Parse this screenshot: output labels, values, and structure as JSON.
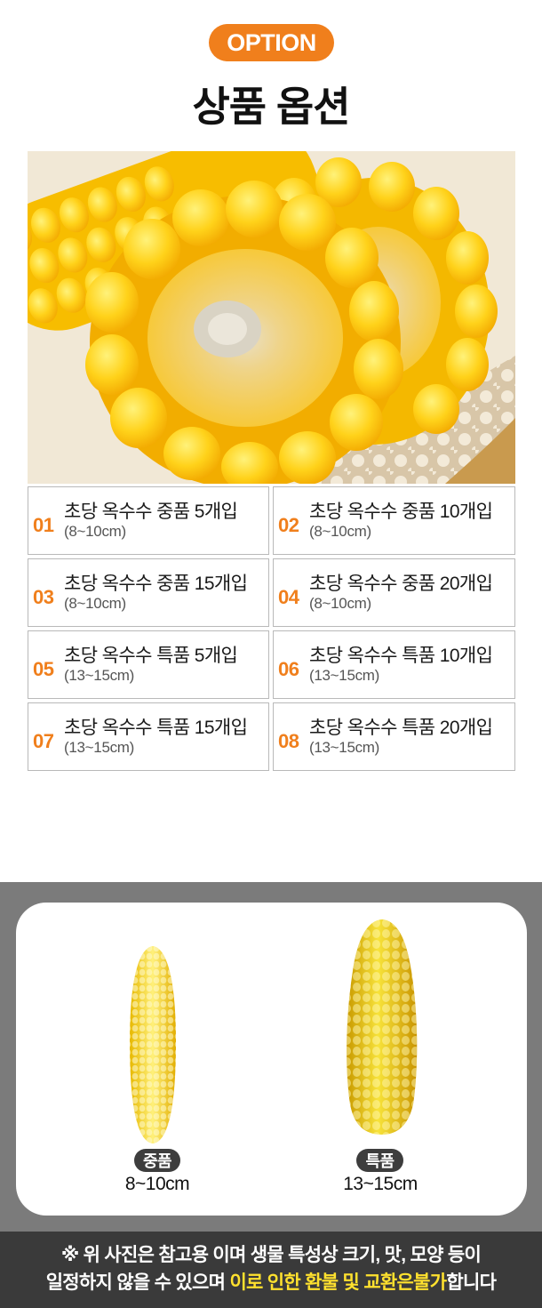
{
  "header": {
    "badge": "OPTION",
    "title": "상품 옵션"
  },
  "options": [
    {
      "num": "01",
      "name": "초당 옥수수 중품 5개입",
      "size": "(8~10cm)"
    },
    {
      "num": "02",
      "name": "초당 옥수수 중품 10개입",
      "size": "(8~10cm)"
    },
    {
      "num": "03",
      "name": "초당 옥수수 중품 15개입",
      "size": "(8~10cm)"
    },
    {
      "num": "04",
      "name": "초당 옥수수 중품 20개입",
      "size": "(8~10cm)"
    },
    {
      "num": "05",
      "name": "초당 옥수수 특품 5개입",
      "size": "(13~15cm)"
    },
    {
      "num": "06",
      "name": "초당 옥수수 특품 10개입",
      "size": "(13~15cm)"
    },
    {
      "num": "07",
      "name": "초당 옥수수 특품 15개입",
      "size": "(13~15cm)"
    },
    {
      "num": "08",
      "name": "초당 옥수수 특품 20개입",
      "size": "(13~15cm)"
    }
  ],
  "comparison": {
    "mid": {
      "grade": "중품",
      "size": "8~10cm"
    },
    "big": {
      "grade": "특품",
      "size": "13~15cm"
    }
  },
  "notice": {
    "line1": "※ 위 사진은 참고용 이며 생물 특성상 크기, 맛, 모양 등이",
    "line2_pre": "일정하지 않을 수 있으며 ",
    "line2_highlight": "이로 인한 환불 및 교환은불가",
    "line2_post": "합니다"
  },
  "colors": {
    "accent": "#f07f1c",
    "highlight": "#ffe12e",
    "band": "#7b7b7b",
    "notice_bg": "#3a3a3a"
  }
}
